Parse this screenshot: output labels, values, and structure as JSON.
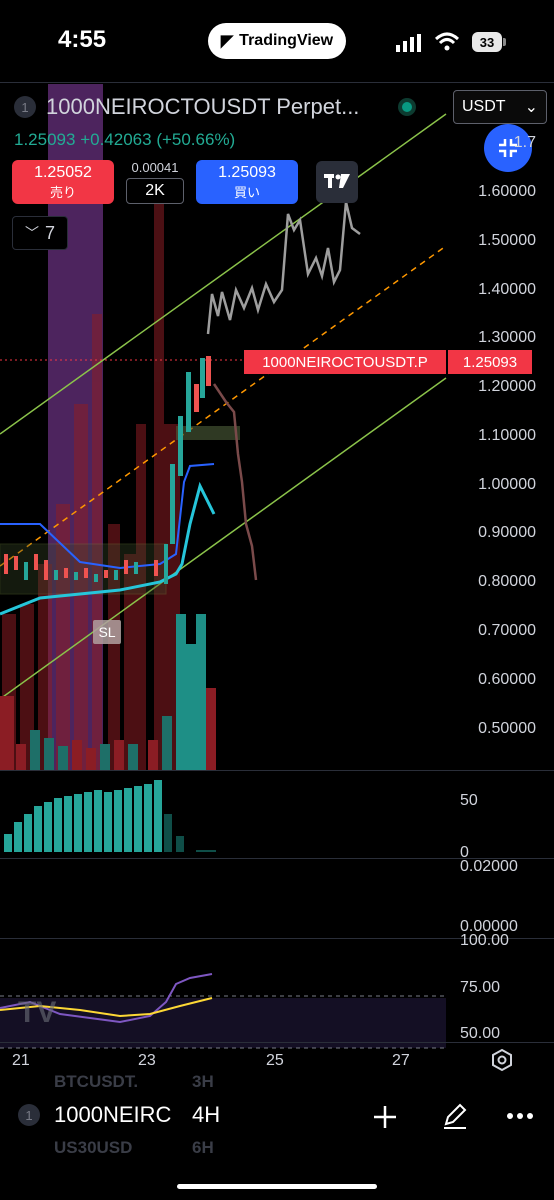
{
  "status_bar": {
    "time": "4:55",
    "app_name": "TradingView",
    "battery": "33"
  },
  "header": {
    "symbol_index": "1",
    "symbol_title": "1000NEIROCTOUSDT Perpet...",
    "currency": "USDT",
    "last_price": "1.25093",
    "change": "+0.42063",
    "change_pct": "(+50.66%)"
  },
  "trade": {
    "sell_price": "1.25052",
    "sell_label": "売り",
    "spread": "0.00041",
    "quantity": "2K",
    "buy_price": "1.25093",
    "buy_label": "買い",
    "collapse_count": "7"
  },
  "price_axis": [
    "1.7",
    "1.60000",
    "1.50000",
    "1.40000",
    "1.30000",
    "1.20000",
    "1.10000",
    "1.00000",
    "0.90000",
    "0.80000",
    "0.70000",
    "0.60000",
    "0.50000"
  ],
  "last_tag": {
    "symbol": "1000NEIROCTOUSDT.P",
    "price": "1.25093"
  },
  "sl_label": "SL",
  "pane2": {
    "top": "50",
    "bottom": "0"
  },
  "pane3": {
    "top": "0.02000",
    "bottom": "0.00000"
  },
  "pane4": {
    "top": "100.00",
    "mid": "75.00",
    "bottom": "50.00"
  },
  "time_axis": [
    "21",
    "23",
    "25",
    "27"
  ],
  "bottom_bar": {
    "ghost_top": "BTCUSDT.",
    "ghost_top_tf": "3H",
    "ghost_bottom": "US30USD",
    "ghost_bottom_tf": "6H",
    "symbol_index": "1",
    "symbol": "1000NEIRC",
    "timeframe": "4H"
  },
  "colors": {
    "up": "#26a69a",
    "down": "#ef5350",
    "accent": "#2962ff",
    "channel": "#8bc34a",
    "midline": "#ff9800"
  }
}
